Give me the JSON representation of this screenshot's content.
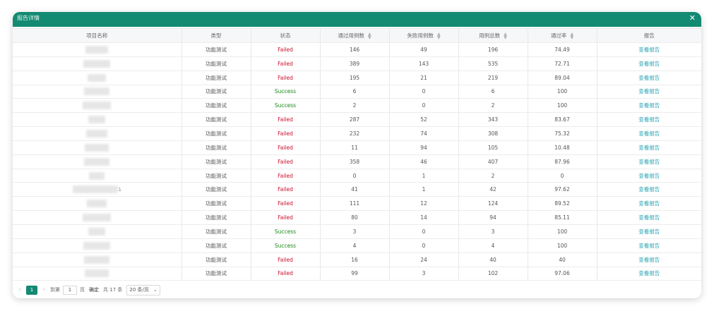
{
  "dialog": {
    "title": "报告详情",
    "close_icon": "✕"
  },
  "table": {
    "headers": {
      "name": "项目名称",
      "type": "类型",
      "status": "状态",
      "passed": "通过用例数",
      "failed": "失败用例数",
      "total": "用例总数",
      "rate": "通过率",
      "report": "报告"
    },
    "rows": [
      {
        "type": "功能测试",
        "status": "Failed",
        "passed": "146",
        "failed": "49",
        "total": "196",
        "rate": "74.49",
        "report": "查看报告"
      },
      {
        "type": "功能测试",
        "status": "Failed",
        "passed": "389",
        "failed": "143",
        "total": "535",
        "rate": "72.71",
        "report": "查看报告"
      },
      {
        "type": "功能测试",
        "status": "Failed",
        "passed": "195",
        "failed": "21",
        "total": "219",
        "rate": "89.04",
        "report": "查看报告"
      },
      {
        "type": "功能测试",
        "status": "Success",
        "passed": "6",
        "failed": "0",
        "total": "6",
        "rate": "100",
        "report": "查看报告"
      },
      {
        "type": "功能测试",
        "status": "Success",
        "passed": "2",
        "failed": "0",
        "total": "2",
        "rate": "100",
        "report": "查看报告"
      },
      {
        "type": "功能测试",
        "status": "Failed",
        "passed": "287",
        "failed": "52",
        "total": "343",
        "rate": "83.67",
        "report": "查看报告"
      },
      {
        "type": "功能测试",
        "status": "Failed",
        "passed": "232",
        "failed": "74",
        "total": "308",
        "rate": "75.32",
        "report": "查看报告"
      },
      {
        "type": "功能测试",
        "status": "Failed",
        "passed": "11",
        "failed": "94",
        "total": "105",
        "rate": "10.48",
        "report": "查看报告"
      },
      {
        "type": "功能测试",
        "status": "Failed",
        "passed": "358",
        "failed": "46",
        "total": "407",
        "rate": "87.96",
        "report": "查看报告"
      },
      {
        "type": "功能测试",
        "status": "Failed",
        "passed": "0",
        "failed": "1",
        "total": "2",
        "rate": "0",
        "report": "查看报告"
      },
      {
        "type": "功能测试",
        "status": "Failed",
        "passed": "41",
        "failed": "1",
        "total": "42",
        "rate": "97.62",
        "report": "查看报告",
        "name_trail": "1"
      },
      {
        "type": "功能测试",
        "status": "Failed",
        "passed": "111",
        "failed": "12",
        "total": "124",
        "rate": "89.52",
        "report": "查看报告"
      },
      {
        "type": "功能测试",
        "status": "Failed",
        "passed": "80",
        "failed": "14",
        "total": "94",
        "rate": "85.11",
        "report": "查看报告"
      },
      {
        "type": "功能测试",
        "status": "Success",
        "passed": "3",
        "failed": "0",
        "total": "3",
        "rate": "100",
        "report": "查看报告"
      },
      {
        "type": "功能测试",
        "status": "Success",
        "passed": "4",
        "failed": "0",
        "total": "4",
        "rate": "100",
        "report": "查看报告"
      },
      {
        "type": "功能测试",
        "status": "Failed",
        "passed": "16",
        "failed": "24",
        "total": "40",
        "rate": "40",
        "report": "查看报告"
      },
      {
        "type": "功能测试",
        "status": "Failed",
        "passed": "99",
        "failed": "3",
        "total": "102",
        "rate": "97.06",
        "report": "查看报告"
      }
    ]
  },
  "pagination": {
    "prev_icon": "‹",
    "next_icon": "›",
    "current_page": "1",
    "goto_label": "到第",
    "goto_value": "1",
    "page_unit": "页",
    "confirm_label": "确定",
    "total_text": "共 17 条",
    "page_size": "20 条/页",
    "chevron_icon": "⌄"
  },
  "colors": {
    "header_bg": "#138a72",
    "failed": "#c8102e",
    "success": "#1a8a18",
    "link": "#2aa5b6"
  }
}
